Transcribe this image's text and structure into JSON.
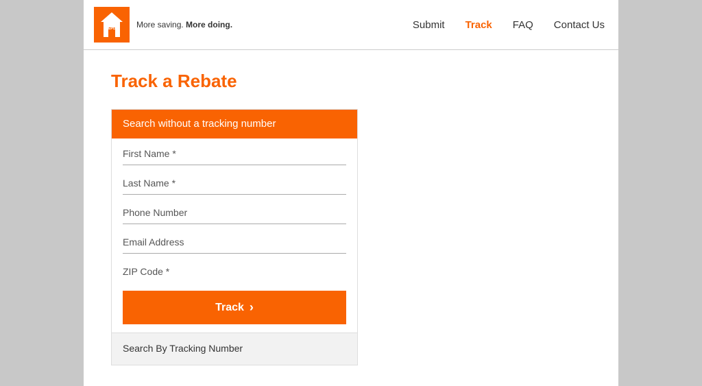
{
  "header": {
    "tagline": "More saving. ",
    "tagline_bold": "More doing.",
    "nav": {
      "submit": "Submit",
      "track": "Track",
      "faq": "FAQ",
      "contact": "Contact Us"
    }
  },
  "page": {
    "title": "Track a Rebate"
  },
  "form": {
    "section_label": "Search without a tracking number",
    "fields": {
      "first_name": "First Name *",
      "last_name": "Last Name *",
      "phone": "Phone Number",
      "email": "Email Address",
      "zip": "ZIP Code *"
    },
    "track_button": "Track",
    "tracking_number_section": "Search By Tracking Number"
  },
  "colors": {
    "brand_orange": "#f96302",
    "nav_active": "#f96302",
    "nav_default": "#333333",
    "bg_gray": "#c8c8c8",
    "white": "#ffffff"
  }
}
